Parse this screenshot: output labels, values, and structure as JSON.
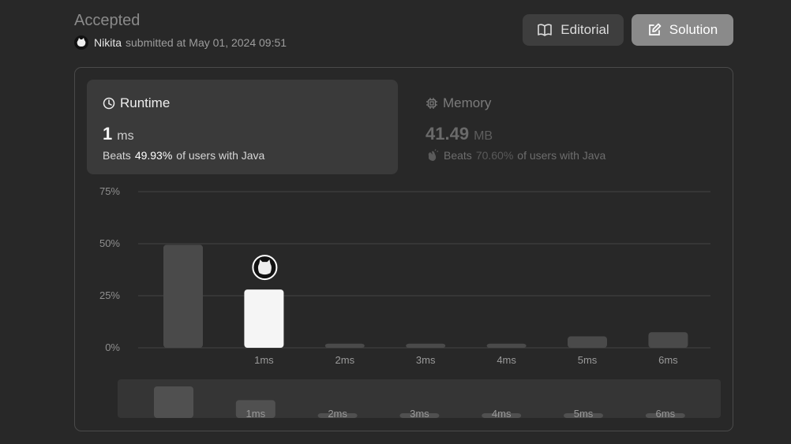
{
  "header": {
    "status": "Accepted",
    "user": "Nikita",
    "submitted_text": "submitted at",
    "timestamp": "May 01, 2024 09:51"
  },
  "buttons": {
    "editorial": "Editorial",
    "solution": "Solution"
  },
  "runtime": {
    "title": "Runtime",
    "value": "1",
    "unit": "ms",
    "beats_label": "Beats",
    "beats_pct": "49.93%",
    "beats_suffix": "of users with Java"
  },
  "memory": {
    "title": "Memory",
    "value": "41.49",
    "unit": "MB",
    "beats_label": "Beats",
    "beats_pct": "70.60%",
    "beats_suffix": "of users with Java"
  },
  "colors": {
    "selected_bar": "#f5f5f5",
    "bar": "#4a4a4a",
    "grid": "#444444"
  },
  "chart_data": {
    "type": "bar",
    "categories": [
      "",
      "1ms",
      "2ms",
      "3ms",
      "4ms",
      "5ms",
      "6ms"
    ],
    "values": [
      49.5,
      28,
      2,
      2,
      2,
      5.5,
      7.5
    ],
    "selected_index": 1,
    "y_ticks": [
      "0%",
      "25%",
      "50%",
      "75%"
    ],
    "ylim": [
      0,
      75
    ],
    "mini_labels": [
      "",
      "1ms",
      "2ms",
      "3ms",
      "4ms",
      "5ms",
      "6ms"
    ],
    "grid": true
  }
}
